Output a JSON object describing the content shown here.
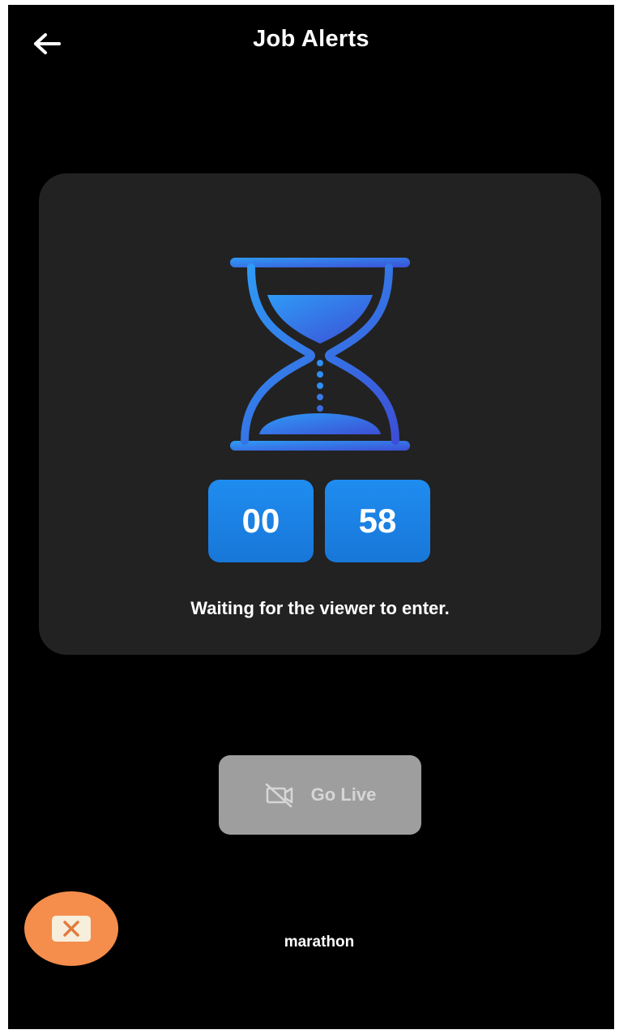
{
  "header": {
    "title": "Job Alerts",
    "back_icon": "arrow-left-icon"
  },
  "countdown": {
    "minutes": "00",
    "seconds": "58",
    "status_text": "Waiting for the viewer to enter.",
    "icon": "hourglass-icon"
  },
  "actions": {
    "go_live_label": "Go Live",
    "go_live_icon": "video-off-icon",
    "fab_icon": "close-mail-icon"
  },
  "footer": {
    "text": "marathon"
  },
  "colors": {
    "background": "#000000",
    "card": "#222222",
    "timer_blue": "#1f8cf0",
    "hourglass_blue_light": "#2f8ff4",
    "hourglass_blue_dark": "#3a52d8",
    "button_disabled": "#9e9e9e",
    "fab_orange": "#f58d4c"
  }
}
